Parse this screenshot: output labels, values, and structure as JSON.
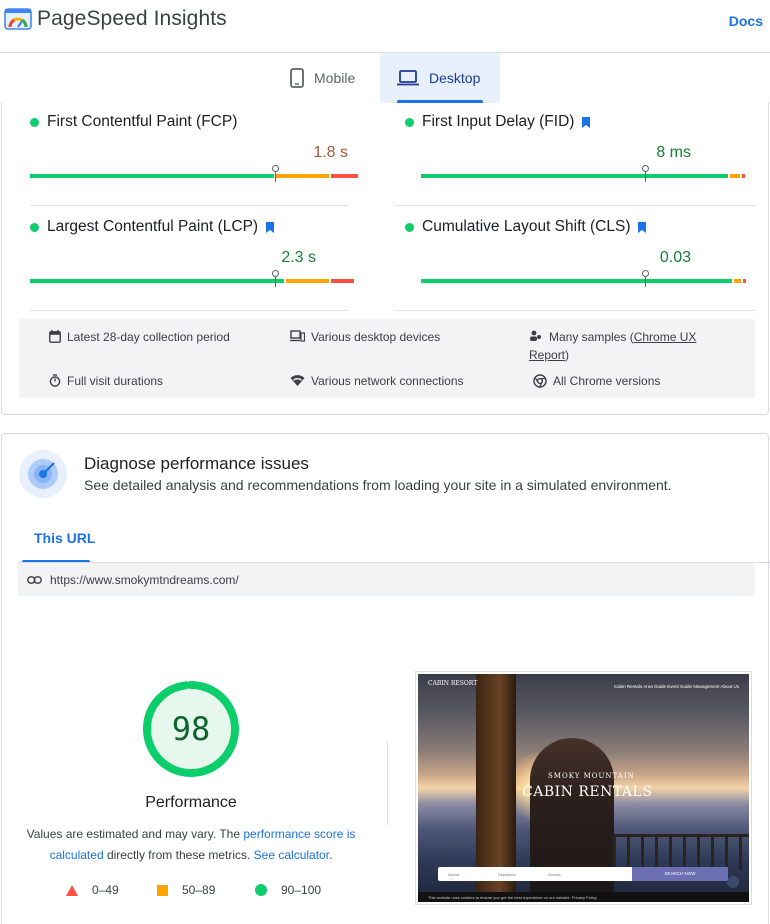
{
  "header": {
    "app_title": "PageSpeed Insights",
    "docs_label": "Docs"
  },
  "tabs": [
    {
      "label": "Mobile",
      "active": false
    },
    {
      "label": "Desktop",
      "active": true
    }
  ],
  "field_metrics": [
    {
      "name": "First Contentful Paint (FCP)",
      "value": "1.8 s",
      "value_color": "#a15c3a",
      "badge": false,
      "split": [
        0.73,
        0.16,
        0.08
      ],
      "position": 0.735
    },
    {
      "name": "First Input Delay (FID)",
      "value": "8 ms",
      "value_color": "#188038",
      "badge": true,
      "split": [
        0.92,
        0.03,
        0.01
      ],
      "position": 0.67
    },
    {
      "name": "Largest Contentful Paint (LCP)",
      "value": "2.3 s",
      "value_color": "#188038",
      "badge": true,
      "split": [
        0.76,
        0.13,
        0.07
      ],
      "position": 0.735
    },
    {
      "name": "Cumulative Layout Shift (CLS)",
      "value": "0.03",
      "value_color": "#188038",
      "badge": true,
      "split": [
        0.93,
        0.02,
        0.01
      ],
      "position": 0.67
    }
  ],
  "info": {
    "collection_period": "Latest 28-day collection period",
    "devices": "Various desktop devices",
    "samples_prefix": "Many samples (",
    "samples_link": "Chrome UX Report",
    "samples_suffix": ")",
    "durations": "Full visit durations",
    "connections": "Various network connections",
    "chrome_versions": "All Chrome versions"
  },
  "diagnose": {
    "title": "Diagnose performance issues",
    "subtitle": "See detailed analysis and recommendations from loading your site in a simulated environment.",
    "tab_label": "This URL",
    "url": "https://www.smokymtndreams.com/"
  },
  "performance": {
    "score": "98",
    "score_fraction": 0.98,
    "label": "Performance",
    "note_prefix": "Values are estimated and may vary. The ",
    "note_link1": "performance score is calculated",
    "note_middle": " directly from these metrics. ",
    "note_link2": "See calculator",
    "note_suffix": "."
  },
  "legend": [
    {
      "range": "0–49",
      "color": "#ff4e42",
      "shape": "triangle-icon"
    },
    {
      "range": "50–89",
      "color": "#ffa400",
      "shape": "square-icon"
    },
    {
      "range": "90–100",
      "color": "#0cce6b",
      "shape": "circle-icon"
    }
  ],
  "site_screenshot": {
    "brand": "CABIN RESORT",
    "nav_links": "Cabin Rentals   Area Guide   Event Guide   Management   About Us",
    "tagline_small": "SMOKY MOUNTAIN",
    "tagline_large": "CABIN RENTALS",
    "booking_arrival": "Arrival",
    "booking_departure": "Departure",
    "booking_guests": "Guests",
    "booking_button": "SEARCH NOW",
    "cookie_text": "This website uses cookies to ensure you get the best experience on our website.",
    "cookie_link": "Privacy Policy"
  }
}
